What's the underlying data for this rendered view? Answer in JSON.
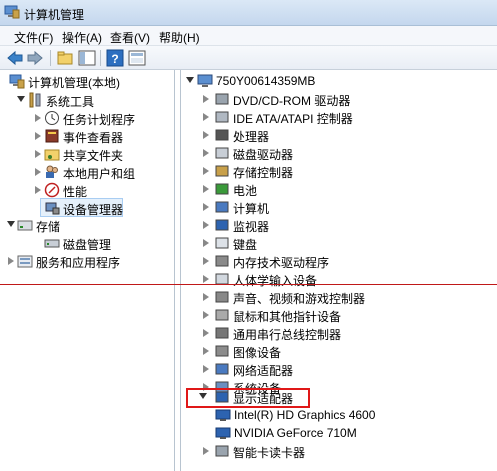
{
  "window": {
    "title": "计算机管理"
  },
  "menu": [
    "文件(F)",
    "操作(A)",
    "查看(V)",
    "帮助(H)"
  ],
  "left_tree": [
    {
      "label": "计算机管理(本地)",
      "icon": "computer-manage-icon"
    },
    {
      "label": "系统工具",
      "icon": "tools-icon"
    },
    {
      "label": "任务计划程序",
      "icon": "clock-icon"
    },
    {
      "label": "事件查看器",
      "icon": "event-viewer-icon"
    },
    {
      "label": "共享文件夹",
      "icon": "shared-folder-icon"
    },
    {
      "label": "本地用户和组",
      "icon": "users-icon"
    },
    {
      "label": "性能",
      "icon": "performance-icon"
    },
    {
      "label": "设备管理器",
      "icon": "device-manager-icon"
    },
    {
      "label": "存储",
      "icon": "storage-icon"
    },
    {
      "label": "磁盘管理",
      "icon": "disk-icon"
    },
    {
      "label": "服务和应用程序",
      "icon": "services-icon"
    }
  ],
  "right_tree": {
    "root": "750Y00614359MB",
    "categories": [
      "DVD/CD-ROM 驱动器",
      "IDE ATA/ATAPI 控制器",
      "处理器",
      "磁盘驱动器",
      "存储控制器",
      "电池",
      "计算机",
      "监视器",
      "键盘",
      "内存技术驱动程序",
      "人体学输入设备",
      "声音、视频和游戏控制器",
      "鼠标和其他指针设备",
      "通用串行总线控制器",
      "图像设备",
      "网络适配器",
      "系统设备",
      "显示适配器",
      "智能卡读卡器"
    ],
    "display_adapters": [
      "Intel(R) HD Graphics 4600",
      "NVIDIA GeForce 710M"
    ]
  }
}
